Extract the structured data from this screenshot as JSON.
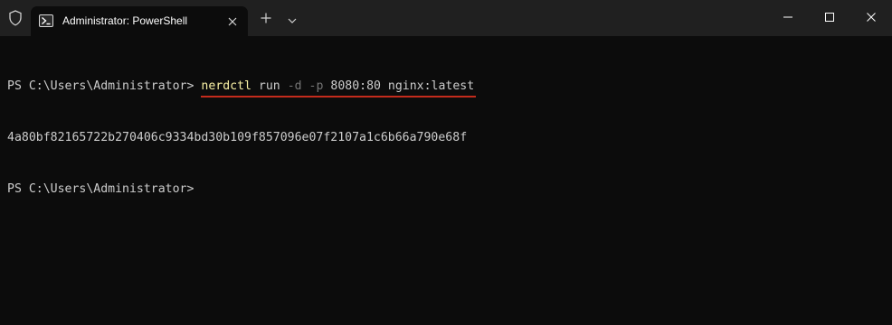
{
  "window": {
    "tab_title": "Administrator: PowerShell",
    "caption_buttons": [
      "minimize",
      "maximize",
      "close"
    ]
  },
  "icons": {
    "shield": "shield-icon",
    "tab": "powershell-icon",
    "tab_close": "close-icon",
    "new_tab": "plus-icon",
    "dropdown": "chevron-down-icon"
  },
  "terminal": {
    "line1_prompt": "PS C:\\Users\\Administrator> ",
    "line1_command": {
      "name": "nerdctl",
      "sub": "run",
      "flag_d": "-d",
      "flag_p": "-p",
      "ports": "8080:80",
      "image": "nginx:latest"
    },
    "line2_output": "4a80bf82165722b270406c9334bd30b109f857096e07f2107a1c6b66a790e68f",
    "line3_prompt": "PS C:\\Users\\Administrator>"
  },
  "colors": {
    "background": "#0c0c0c",
    "titlebar": "#202020",
    "command_name": "#f9f1a5",
    "parameter": "#767676",
    "text": "#cccccc",
    "highlight_underline": "#c42b1c"
  }
}
